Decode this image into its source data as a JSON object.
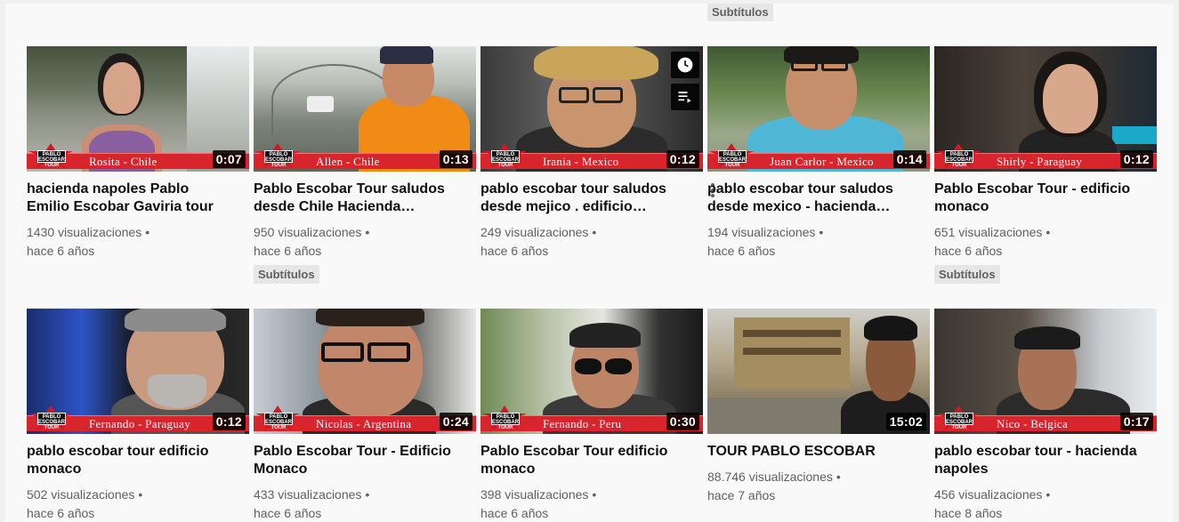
{
  "top_badge": "Subtítulos",
  "videos": [
    {
      "title": "hacienda napoles Pablo Emilio Escobar Gaviria tour",
      "views": "1430 visualizaciones",
      "age": "hace 6 años",
      "duration": "0:07",
      "banner": "Rosita - Chile",
      "badge": "",
      "logo_text": "PABLO ESCOBAR TOUR"
    },
    {
      "title": "Pablo Escobar Tour saludos desde Chile Hacienda…",
      "views": "950 visualizaciones",
      "age": "hace 6 años",
      "duration": "0:13",
      "banner": "Allen - Chile",
      "badge": "Subtítulos",
      "logo_text": "PABLO ESCOBAR TOUR"
    },
    {
      "title": "pablo escobar tour saludos desde mejico . edificio…",
      "views": "249 visualizaciones",
      "age": "hace 6 años",
      "duration": "0:12",
      "banner": "Irania - Mexico",
      "badge": "",
      "logo_text": "PABLO ESCOBAR TOUR"
    },
    {
      "title": "pablo escobar tour saludos desde mexico - hacienda…",
      "views": "194 visualizaciones",
      "age": "hace 6 años",
      "duration": "0:14",
      "banner": "Juan Carlor - Mexico",
      "badge": "",
      "logo_text": "PABLO ESCOBAR TOUR"
    },
    {
      "title": "Pablo Escobar Tour - edificio monaco",
      "views": "651 visualizaciones",
      "age": "hace 6 años",
      "duration": "0:12",
      "banner": "Shirly - Paraguay",
      "badge": "Subtítulos",
      "logo_text": "PABLO ESCOBAR TOUR"
    },
    {
      "title": "pablo escobar tour edificio monaco",
      "views": "502 visualizaciones",
      "age": "hace 6 años",
      "duration": "0:12",
      "banner": "Fernando - Paraguay",
      "badge": "",
      "logo_text": "PABLO ESCOBAR TOUR"
    },
    {
      "title": "Pablo Escobar Tour - Edificio Monaco",
      "views": "433 visualizaciones",
      "age": "hace 6 años",
      "duration": "0:24",
      "banner": "Nicolas - Argentina",
      "badge": "",
      "logo_text": "PABLO ESCOBAR TOUR"
    },
    {
      "title": "Pablo Escobar Tour edificio monaco",
      "views": "398 visualizaciones",
      "age": "hace 6 años",
      "duration": "0:30",
      "banner": "Fernando - Peru",
      "badge": "",
      "logo_text": "PABLO ESCOBAR TOUR"
    },
    {
      "title": "TOUR PABLO ESCOBAR",
      "views": "88.746 visualizaciones",
      "age": "hace 7 años",
      "duration": "15:02",
      "banner": "",
      "badge": "",
      "logo_text": ""
    },
    {
      "title": "pablo escobar tour - hacienda napoles",
      "views": "456 visualizaciones",
      "age": "hace 8 años",
      "duration": "0:17",
      "banner": "Nico - Belgica",
      "badge": "",
      "logo_text": "PABLO ESCOBAR TOUR"
    }
  ],
  "colors": {
    "banner_red": "#d8242c",
    "page_bg": "#f9f9f9",
    "meta_text": "#606060"
  },
  "icons": {
    "watch_later": "clock-icon",
    "add_to_queue": "queue-icon",
    "more": "more-vert-icon"
  }
}
